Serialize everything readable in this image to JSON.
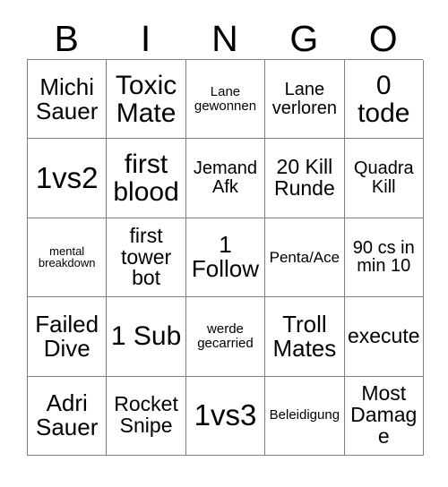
{
  "card": {
    "header": {
      "letters": [
        "B",
        "I",
        "N",
        "G",
        "O"
      ]
    },
    "rows": [
      [
        {
          "text": "Michi Sauer",
          "size": "fs-l"
        },
        {
          "text": "Toxic Mate",
          "size": "fs-xl"
        },
        {
          "text": "Lane gewonnen",
          "size": "fs-xxs"
        },
        {
          "text": "Lane verloren",
          "size": "fs-s"
        },
        {
          "text": "0 tode",
          "size": "fs-xl"
        }
      ],
      [
        {
          "text": "1vs2",
          "size": "fs-xxl"
        },
        {
          "text": "first blood",
          "size": "fs-xl"
        },
        {
          "text": "Jemand Afk",
          "size": "fs-s"
        },
        {
          "text": "20 Kill Runde",
          "size": "fs-m"
        },
        {
          "text": "Quadra Kill",
          "size": "fs-s"
        }
      ],
      [
        {
          "text": "mental breakdown",
          "size": "fs-tiny"
        },
        {
          "text": "first tower bot",
          "size": "fs-m"
        },
        {
          "text": "1 Follow",
          "size": "fs-l"
        },
        {
          "text": "Penta/Ace",
          "size": "fs-xs"
        },
        {
          "text": "90 cs in min 10",
          "size": "fs-s"
        }
      ],
      [
        {
          "text": "Failed Dive",
          "size": "fs-l"
        },
        {
          "text": "1 Sub",
          "size": "fs-xl"
        },
        {
          "text": "werde gecarried",
          "size": "fs-xxs"
        },
        {
          "text": "Troll Mates",
          "size": "fs-l"
        },
        {
          "text": "execute",
          "size": "fs-m"
        }
      ],
      [
        {
          "text": "Adri Sauer",
          "size": "fs-l"
        },
        {
          "text": "Rocket Snipe",
          "size": "fs-m"
        },
        {
          "text": "1vs3",
          "size": "fs-xxl"
        },
        {
          "text": "Beleidigung",
          "size": "fs-xxs"
        },
        {
          "text": "Most Damage",
          "size": "fs-m"
        }
      ]
    ],
    "colors": {
      "grid_line": "#808080",
      "text": "#000000",
      "background": "#ffffff"
    }
  }
}
